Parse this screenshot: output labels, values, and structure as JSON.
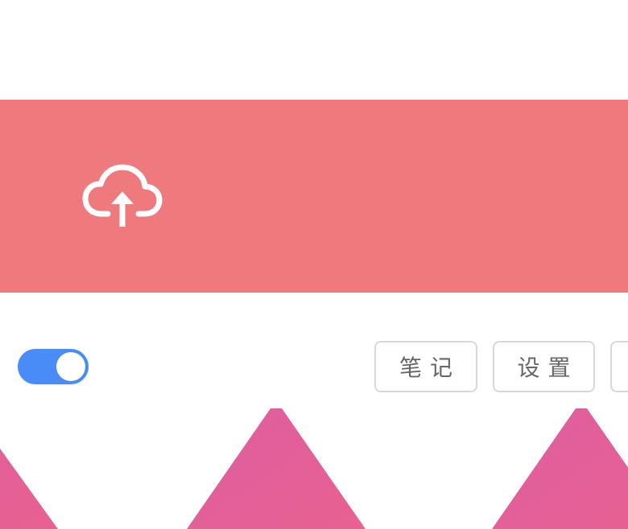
{
  "upload": {
    "icon": "cloud-upload-icon",
    "banner_color": "#ef7a7e"
  },
  "toggle": {
    "state": "on",
    "accent_color": "#4a8cf7"
  },
  "toolbar": {
    "notes_label": "笔记",
    "settings_label": "设置"
  },
  "decoration": {
    "pattern": "triangles",
    "color": "#e45c9a"
  }
}
